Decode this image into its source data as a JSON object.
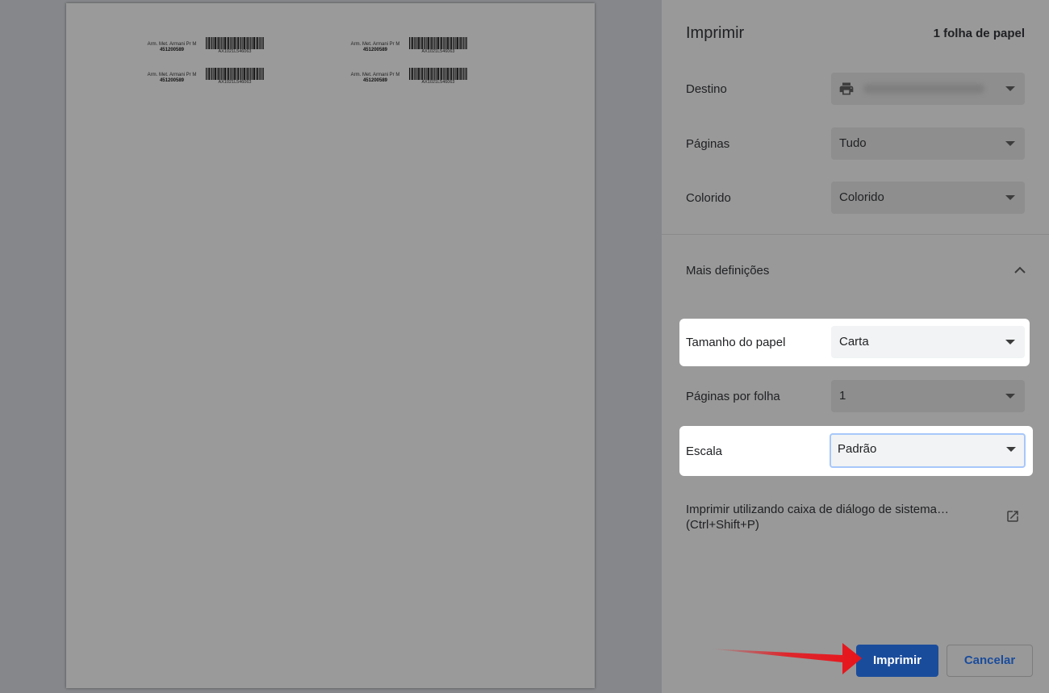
{
  "preview": {
    "labels": [
      {
        "name": "Arm. Met. Armani Pr M",
        "code": "451200589",
        "barcode_text": "AX1021L546063"
      },
      {
        "name": "Arm. Met. Armani Pr M",
        "code": "451200589",
        "barcode_text": "AX1021L546063"
      },
      {
        "name": "Arm. Met. Armani Pr M",
        "code": "451200589",
        "barcode_text": "AX1021L546063"
      },
      {
        "name": "Arm. Met. Armani Pr M",
        "code": "451200589",
        "barcode_text": "AX1021L546063"
      }
    ]
  },
  "panel": {
    "title": "Imprimir",
    "sheet_count": "1 folha de papel",
    "destination": {
      "label": "Destino",
      "icon": "printer-icon"
    },
    "pages": {
      "label": "Páginas",
      "value": "Tudo"
    },
    "color": {
      "label": "Colorido",
      "value": "Colorido"
    },
    "more_settings": {
      "label": "Mais definições",
      "icon": "chevron-up-icon"
    },
    "paper_size": {
      "label": "Tamanho do papel",
      "value": "Carta"
    },
    "pages_per_sheet": {
      "label": "Páginas por folha",
      "value": "1"
    },
    "scale": {
      "label": "Escala",
      "value": "Padrão"
    },
    "system_dialog": {
      "line1": "Imprimir utilizando caixa de diálogo de sistema…",
      "line2": "(Ctrl+Shift+P)",
      "icon": "open-external-icon"
    },
    "buttons": {
      "print": "Imprimir",
      "cancel": "Cancelar"
    }
  },
  "colors": {
    "primary": "#1a4c9c",
    "annotation_arrow": "#e8141b",
    "highlight": "#ffffff"
  }
}
